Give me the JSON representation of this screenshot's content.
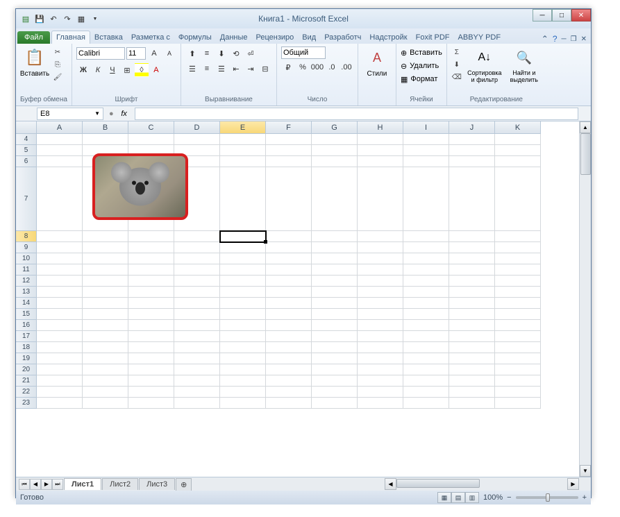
{
  "title": "Книга1 - Microsoft Excel",
  "tabs": {
    "file": "Файл",
    "list": [
      "Главная",
      "Вставка",
      "Разметка с",
      "Формулы",
      "Данные",
      "Рецензиро",
      "Вид",
      "Разработч",
      "Надстройк",
      "Foxit PDF",
      "ABBYY PDF"
    ],
    "active": "Главная"
  },
  "ribbon": {
    "clipboard": {
      "label": "Буфер обмена",
      "paste": "Вставить"
    },
    "font": {
      "label": "Шрифт",
      "name": "Calibri",
      "size": "11"
    },
    "alignment": {
      "label": "Выравнивание"
    },
    "number": {
      "label": "Число",
      "format": "Общий"
    },
    "styles": {
      "label": "",
      "styles_btn": "Стили"
    },
    "cells": {
      "label": "Ячейки",
      "insert": "Вставить",
      "delete": "Удалить",
      "format": "Формат"
    },
    "editing": {
      "label": "Редактирование",
      "sort": "Сортировка и фильтр",
      "find": "Найти и выделить"
    }
  },
  "namebox": "E8",
  "columns": [
    "A",
    "B",
    "C",
    "D",
    "E",
    "F",
    "G",
    "H",
    "I",
    "J",
    "K"
  ],
  "selected_col": "E",
  "rows": [
    4,
    5,
    6,
    7,
    8,
    9,
    10,
    11,
    12,
    13,
    14,
    15,
    16,
    17,
    18,
    19,
    20,
    21,
    22,
    23
  ],
  "selected_row": 8,
  "tall_row": 7,
  "sheets": [
    "Лист1",
    "Лист2",
    "Лист3"
  ],
  "active_sheet": "Лист1",
  "status": "Готово",
  "zoom": "100%",
  "image_desc": "koala"
}
